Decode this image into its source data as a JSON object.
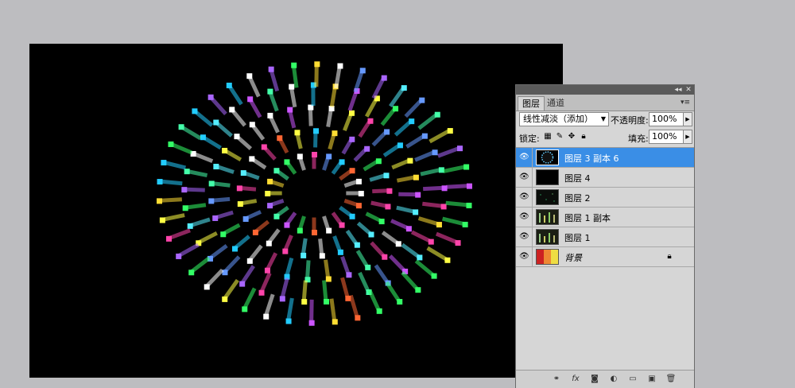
{
  "panel": {
    "tabs": [
      {
        "label": "图层"
      },
      {
        "label": "通道"
      }
    ],
    "blend_mode": "线性减淡（添加）",
    "opacity_label": "不透明度:",
    "opacity_value": "100%",
    "lock_label": "锁定:",
    "fill_label": "填充:",
    "fill_value": "100%",
    "layers": [
      {
        "name": "图层 3 副本 6",
        "selected": true,
        "thumb": "fireworks"
      },
      {
        "name": "图层 4",
        "selected": false,
        "thumb": "black"
      },
      {
        "name": "图层 2",
        "selected": false,
        "thumb": "dark-noise"
      },
      {
        "name": "图层 1 副本",
        "selected": false,
        "thumb": "city"
      },
      {
        "name": "图层 1",
        "selected": false,
        "thumb": "city"
      },
      {
        "name": "背景",
        "selected": false,
        "thumb": "colorful",
        "locked": true
      }
    ],
    "colors": {
      "selection": "#3a8ee6"
    }
  }
}
